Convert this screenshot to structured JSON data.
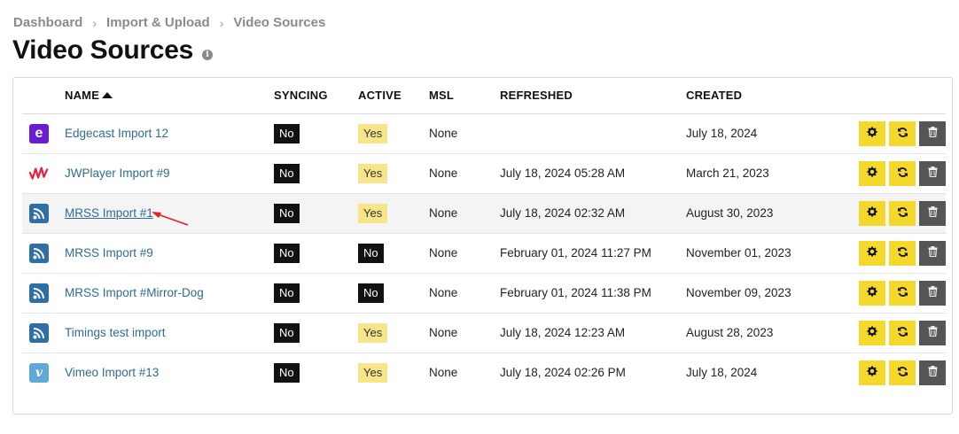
{
  "breadcrumb": [
    "Dashboard",
    "Import & Upload",
    "Video Sources"
  ],
  "page_title": "Video Sources",
  "table": {
    "headers": {
      "name": "NAME",
      "syncing": "SYNCING",
      "active": "ACTIVE",
      "msl": "MSL",
      "refreshed": "REFRESHED",
      "created": "CREATED"
    },
    "rows": [
      {
        "icon": "edgecast-icon",
        "name": "Edgecast Import 12",
        "syncing": "No",
        "active": "Yes",
        "msl": "None",
        "refreshed": "",
        "created": "July 18, 2024"
      },
      {
        "icon": "jwplayer-icon",
        "name": "JWPlayer Import #9",
        "syncing": "No",
        "active": "Yes",
        "msl": "None",
        "refreshed": "July 18, 2024 05:28 AM",
        "created": "March 21, 2023"
      },
      {
        "icon": "rss-icon",
        "name": "MRSS Import #1",
        "syncing": "No",
        "active": "Yes",
        "msl": "None",
        "refreshed": "July 18, 2024 02:32 AM",
        "created": "August 30, 2023"
      },
      {
        "icon": "rss-icon",
        "name": "MRSS Import #9",
        "syncing": "No",
        "active": "No",
        "msl": "None",
        "refreshed": "February 01, 2024 11:27 PM",
        "created": "November 01, 2023"
      },
      {
        "icon": "rss-icon",
        "name": "MRSS Import #Mirror-Dog",
        "syncing": "No",
        "active": "No",
        "msl": "None",
        "refreshed": "February 01, 2024 11:38 PM",
        "created": "November 09, 2023"
      },
      {
        "icon": "rss-icon",
        "name": "Timings test import",
        "syncing": "No",
        "active": "Yes",
        "msl": "None",
        "refreshed": "July 18, 2024 12:23 AM",
        "created": "August 28, 2023"
      },
      {
        "icon": "vimeo-icon",
        "name": "Vimeo Import #13",
        "syncing": "No",
        "active": "Yes",
        "msl": "None",
        "refreshed": "July 18, 2024 02:26 PM",
        "created": "July 18, 2024"
      }
    ]
  },
  "icons": {
    "edgecast_letter": "e",
    "vimeo_letter": "v"
  },
  "colors": {
    "link": "#2f6b94",
    "yes_badge": "#f8e58a",
    "no_badge": "#111111",
    "action_yellow": "#f4d82b",
    "action_gray": "#555555",
    "arrow": "#e0202a"
  }
}
